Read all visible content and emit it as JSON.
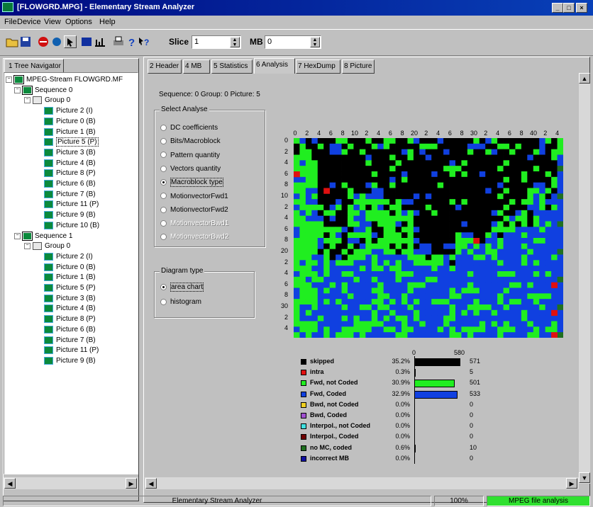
{
  "window": {
    "title": "[FLOWGRD.MPG] - Elementary Stream Analyzer",
    "minimize": "_",
    "maximize": "□",
    "close": "×"
  },
  "menu": [
    "File",
    "Device",
    "View",
    "Options",
    "Help"
  ],
  "toolbar": {
    "slice_label": "Slice",
    "slice_value": "1",
    "mb_label": "MB",
    "mb_value": "0"
  },
  "left_tab": "1 Tree Navigator",
  "tree": {
    "root": "MPEG-Stream FLOWGRD.MF",
    "sequences": [
      {
        "label": "Sequence 0",
        "group": "Group 0",
        "pictures": [
          "Picture 2 (I)",
          "Picture 0 (B)",
          "Picture 1 (B)",
          "Picture 5 (P)",
          "Picture 3 (B)",
          "Picture 4 (B)",
          "Picture 8 (P)",
          "Picture 6 (B)",
          "Picture 7 (B)",
          "Picture 11 (P)",
          "Picture 9 (B)",
          "Picture 10 (B)"
        ]
      },
      {
        "label": "Sequence 1",
        "group": "Group 0",
        "pictures": [
          "Picture 2 (I)",
          "Picture 0 (B)",
          "Picture 1 (B)",
          "Picture 5 (P)",
          "Picture 3 (B)",
          "Picture 4 (B)",
          "Picture 8 (P)",
          "Picture 6 (B)",
          "Picture 7 (B)",
          "Picture 11 (P)",
          "Picture 9 (B)"
        ]
      }
    ]
  },
  "tabs": [
    "2 Header",
    "4 MB",
    "5 Statistics",
    "6 Analysis",
    "7 HexDump",
    "8 Picture"
  ],
  "active_tab": "6 Analysis",
  "info_line": "Sequence: 0  Group: 0  Picture: 5",
  "select_analyse": {
    "title": "Select Analyse",
    "options": [
      "DC coefficients",
      "Bits/Macroblock",
      "Pattern quantity",
      "Vectors quantity",
      "Macroblock type",
      "MotionvectorFwd1",
      "MotionvectorFwd2",
      "MotionvectorBwd1",
      "MotionvectorBwd2"
    ],
    "selected": "Macroblock type"
  },
  "diagram_type": {
    "title": "Diagram type",
    "options": [
      "area chart",
      "histogram"
    ],
    "selected": "area chart"
  },
  "heatmap": {
    "x_ticks": [
      "0",
      "2",
      "4",
      "6",
      "8",
      "10",
      "2",
      "4",
      "6",
      "8",
      "20",
      "2",
      "4",
      "6",
      "8",
      "30",
      "2",
      "4",
      "6",
      "8",
      "40",
      "2",
      "4"
    ],
    "y_ticks": [
      "0",
      "2",
      "4",
      "6",
      "8",
      "10",
      "2",
      "4",
      "6",
      "8",
      "20",
      "2",
      "4",
      "6",
      "8",
      "30",
      "2",
      "4"
    ]
  },
  "legend": {
    "axis_min": "0",
    "axis_max": "580",
    "max_value": 580,
    "items": [
      {
        "label": "skipped",
        "percent": "35.2%",
        "count": "571",
        "value": 571,
        "color": "#000000"
      },
      {
        "label": "intra",
        "percent": "0.3%",
        "count": "5",
        "value": 5,
        "color": "#e01010"
      },
      {
        "label": "Fwd, not Coded",
        "percent": "30.9%",
        "count": "501",
        "value": 501,
        "color": "#20ee20"
      },
      {
        "label": "Fwd, Coded",
        "percent": "32.9%",
        "count": "533",
        "value": 533,
        "color": "#1040e0"
      },
      {
        "label": "Bwd, not Coded",
        "percent": "0.0%",
        "count": "0",
        "value": 0,
        "color": "#f0d020"
      },
      {
        "label": "Bwd, Coded",
        "percent": "0.0%",
        "count": "0",
        "value": 0,
        "color": "#a050d0"
      },
      {
        "label": "Interpol., not Coded",
        "percent": "0.0%",
        "count": "0",
        "value": 0,
        "color": "#40e0e0"
      },
      {
        "label": "Interpol., Coded",
        "percent": "0.0%",
        "count": "0",
        "value": 0,
        "color": "#700000"
      },
      {
        "label": "no MC, coded",
        "percent": "0.6%",
        "count": "10",
        "value": 10,
        "color": "#207020"
      },
      {
        "label": "incorrect MB",
        "percent": "0.0%",
        "count": "0",
        "value": 0,
        "color": "#1010a0"
      }
    ]
  },
  "status": {
    "main": "Elementary Stream Analyzer",
    "zoom": "100%",
    "state": "MPEG file analysis"
  }
}
